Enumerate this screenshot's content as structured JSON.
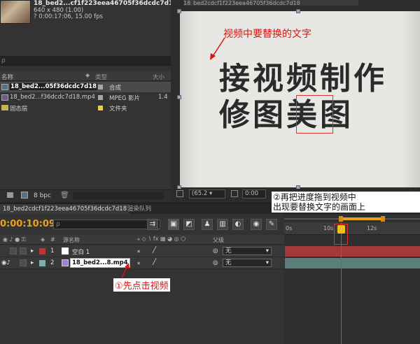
{
  "project": {
    "footage_name": "18_bed2...cf1f223eea46705f36dcdc7d18",
    "footage_dims": "640 x 480 (1.00)",
    "footage_duration": "? 0:00:17:06, 15.00 fps",
    "columns": {
      "name": "名称",
      "type": "类型",
      "size": "大小"
    },
    "items": [
      {
        "name": "18_bed2...05f36dcdc7d18",
        "type": "合成",
        "color": "#a6a6a6",
        "icon": "composition-icon",
        "selected": true
      },
      {
        "name": "18_bed2...f36dcdc7d18.mp4",
        "type": "MPEG 影片",
        "extra": "1.4",
        "color": "#a6a6a6",
        "icon": "film-icon"
      },
      {
        "name": "固态层",
        "type": "文件夹",
        "color": "#e6d04a",
        "icon": "folder-icon"
      }
    ],
    "bpc": "8 bpc"
  },
  "viewer": {
    "tab_title": "18_bed2cdcf1f223eea46705f36dcdc7d18",
    "annotation": "视频中要替换的文字",
    "calligraphy_line1": "接视频制作",
    "calligraphy_line2": "修图美图",
    "zoom": "(65.2",
    "time": "0:00",
    "label_right": "有效"
  },
  "tabs": {
    "comp_tab": "18_bed2cdcf1f223eea46705f36dcdc7d18",
    "render_queue": "渲染队列"
  },
  "timeline": {
    "timecode": "0:00:10:09",
    "col_num": "#",
    "col_source": "源名称",
    "col_parent": "父级",
    "ruler_labels": [
      "0s",
      "10s",
      "12s"
    ],
    "layers": [
      {
        "index": "1",
        "name": "空白 1",
        "label_color": "#c03434",
        "icon_color": "#ffffff",
        "parent": "无"
      },
      {
        "index": "2",
        "name": "18_bed2...8.mp4",
        "label_color": "#7fb0aa",
        "icon_color": "#9b7fd0",
        "parent": "无"
      }
    ]
  },
  "annotations": {
    "step1": "①先点击视频",
    "step2_line1": "②再把进度拖到视频中",
    "step2_line2": "出现要替换文字的画面上"
  }
}
